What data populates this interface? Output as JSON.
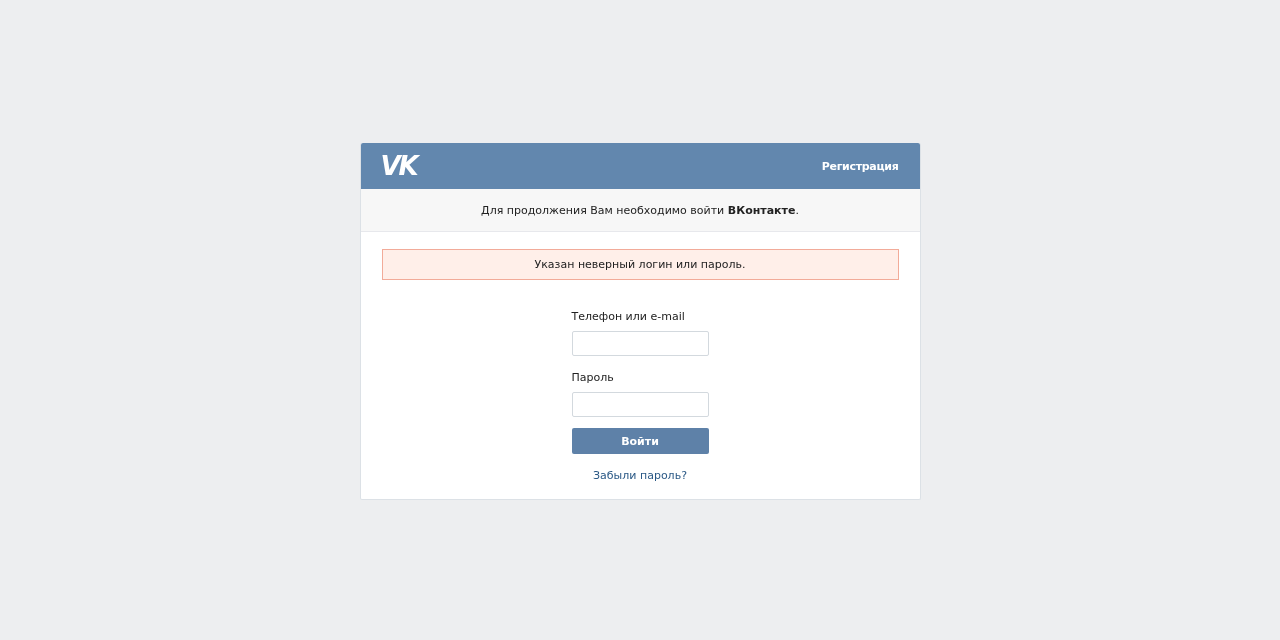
{
  "header": {
    "logo": "VK",
    "register_link": "Регистрация"
  },
  "notice": "Для продолжения Вам необходимо войти **ВКонтакте**.",
  "error": "Указан неверный логин или пароль.",
  "form": {
    "fields": [
      {
        "label": "Телефон или e-mail"
      },
      {
        "label": "Пароль"
      }
    ],
    "submit": "Войти",
    "forgot_link": "Забыли пароль?"
  }
}
